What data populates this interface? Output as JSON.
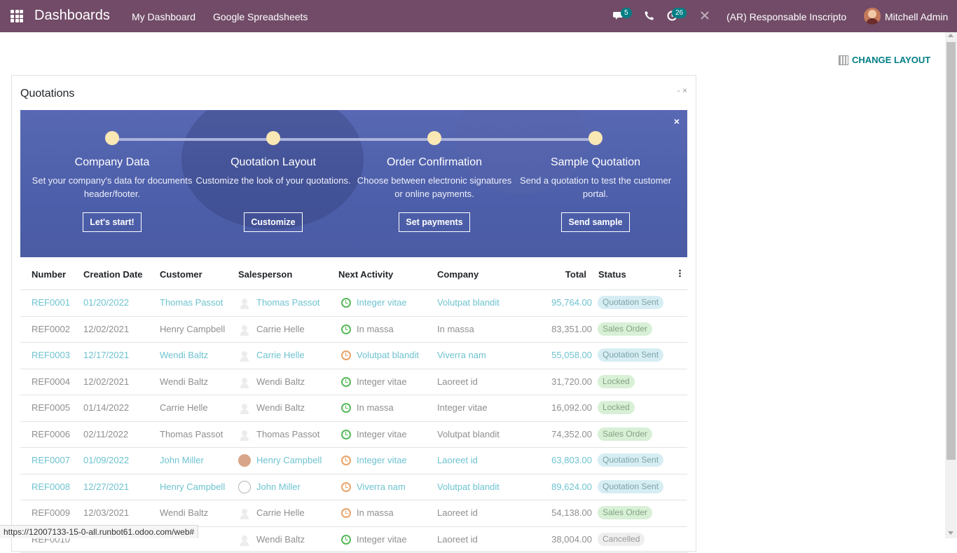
{
  "navbar": {
    "title": "Dashboards",
    "menu": [
      "My Dashboard",
      "Google Spreadsheets"
    ],
    "messages_badge": "5",
    "activities_badge": "26",
    "company": "(AR) Responsable Inscripto",
    "user": "Mitchell Admin",
    "color": "#714b67"
  },
  "toolbar": {
    "change_layout": "CHANGE LAYOUT"
  },
  "panel": {
    "title": "Quotations",
    "controls": "- ×"
  },
  "onboarding": {
    "close": "×",
    "steps": [
      {
        "title": "Company Data",
        "desc": "Set your company's data for documents header/footer.",
        "button": "Let's start!"
      },
      {
        "title": "Quotation Layout",
        "desc": "Customize the look of your quotations.",
        "button": "Customize"
      },
      {
        "title": "Order Confirmation",
        "desc": "Choose between electronic signatures or online payments.",
        "button": "Set payments"
      },
      {
        "title": "Sample Quotation",
        "desc": "Send a quotation to test the customer portal.",
        "button": "Send sample"
      }
    ]
  },
  "table": {
    "columns": [
      "Number",
      "Creation Date",
      "Customer",
      "Salesperson",
      "Next Activity",
      "Company",
      "Total",
      "Status"
    ],
    "rows": [
      {
        "number": "REF0001",
        "date": "01/20/2022",
        "customer": "Thomas Passot",
        "salesperson": "Thomas Passot",
        "activity": "Integer vitae",
        "company": "Volutpat blandit",
        "total": "95,764.00",
        "status": "Quotation Sent"
      },
      {
        "number": "REF0002",
        "date": "12/02/2021",
        "customer": "Henry Campbell",
        "salesperson": "Carrie Helle",
        "activity": "In massa",
        "company": "In massa",
        "total": "83,351.00",
        "status": "Sales Order"
      },
      {
        "number": "REF0003",
        "date": "12/17/2021",
        "customer": "Wendi Baltz",
        "salesperson": "Carrie Helle",
        "activity": "Volutpat blandit",
        "company": "Viverra nam",
        "total": "55,058.00",
        "status": "Quotation Sent"
      },
      {
        "number": "REF0004",
        "date": "12/02/2021",
        "customer": "Wendi Baltz",
        "salesperson": "Wendi Baltz",
        "activity": "Integer vitae",
        "company": "Laoreet id",
        "total": "31,720.00",
        "status": "Locked"
      },
      {
        "number": "REF0005",
        "date": "01/14/2022",
        "customer": "Carrie Helle",
        "salesperson": "Wendi Baltz",
        "activity": "In massa",
        "company": "Integer vitae",
        "total": "16,092.00",
        "status": "Locked"
      },
      {
        "number": "REF0006",
        "date": "02/11/2022",
        "customer": "Thomas Passot",
        "salesperson": "Thomas Passot",
        "activity": "Integer vitae",
        "company": "Volutpat blandit",
        "total": "74,352.00",
        "status": "Sales Order"
      },
      {
        "number": "REF0007",
        "date": "01/09/2022",
        "customer": "John Miller",
        "salesperson": "Henry Campbell",
        "activity": "Integer vitae",
        "company": "Laoreet id",
        "total": "63,803.00",
        "status": "Quotation Sent"
      },
      {
        "number": "REF0008",
        "date": "12/27/2021",
        "customer": "Henry Campbell",
        "salesperson": "John Miller",
        "activity": "Viverra nam",
        "company": "Volutpat blandit",
        "total": "89,624.00",
        "status": "Quotation Sent"
      },
      {
        "number": "REF0009",
        "date": "12/03/2021",
        "customer": "Wendi Baltz",
        "salesperson": "Carrie Helle",
        "activity": "In massa",
        "company": "Laoreet id",
        "total": "54,138.00",
        "status": "Sales Order"
      },
      {
        "number": "REF0010",
        "date": "",
        "customer": "",
        "salesperson": "Wendi Baltz",
        "activity": "Integer vitae",
        "company": "Laoreet id",
        "total": "38,004.00",
        "status": "Cancelled"
      }
    ]
  },
  "status_url": "https://12007133-15-0-all.runbot61.odoo.com/web#"
}
